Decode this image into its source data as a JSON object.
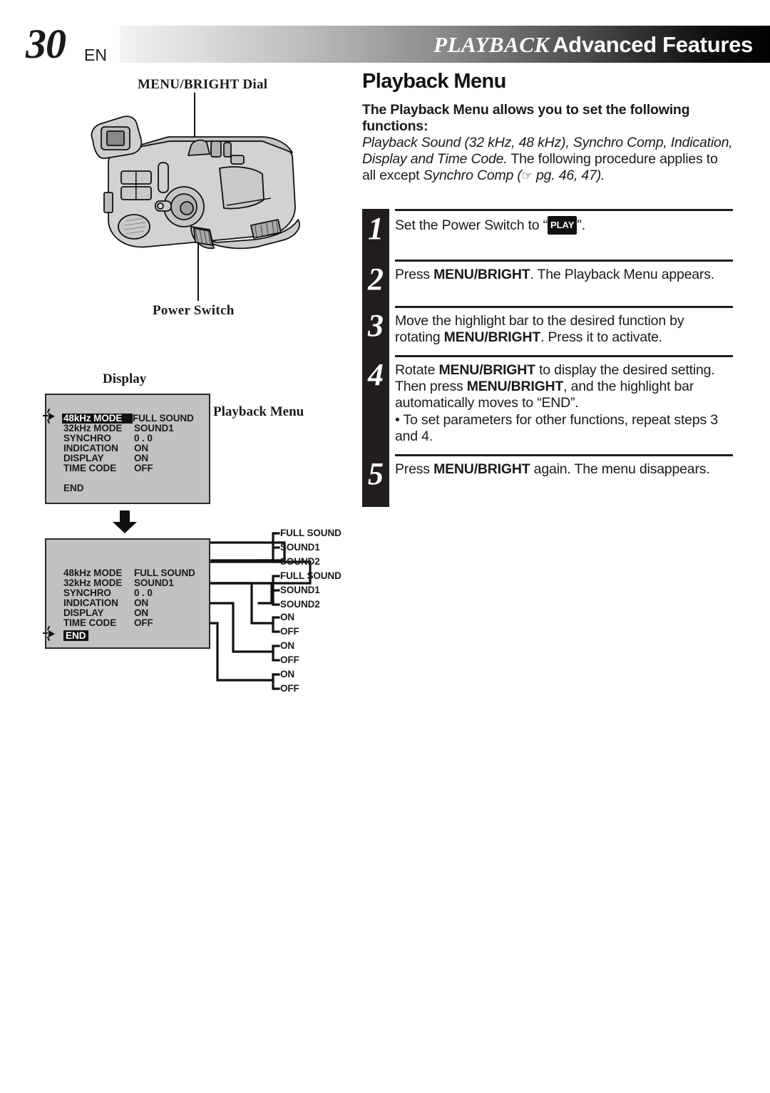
{
  "header": {
    "page_number": "30",
    "language": "EN",
    "title_italic": "PLAYBACK",
    "title_bold": "Advanced Features"
  },
  "illustration": {
    "label_dial": "MENU/BRIGHT Dial",
    "label_power": "Power Switch"
  },
  "screens": {
    "label_display": "Display",
    "label_playback_menu": "Playback Menu",
    "columns": [
      "function",
      "setting"
    ],
    "screen1": {
      "rows": [
        {
          "name": "48kHz  MODE",
          "value": "FULL SOUND",
          "highlighted": true
        },
        {
          "name": "32kHz  MODE",
          "value": "SOUND1",
          "highlighted": false
        },
        {
          "name": "SYNCHRO",
          "value": "0 . 0",
          "highlighted": false
        },
        {
          "name": "INDICATION",
          "value": "ON",
          "highlighted": false
        },
        {
          "name": "DISPLAY",
          "value": "ON",
          "highlighted": false
        },
        {
          "name": "TIME CODE",
          "value": "OFF",
          "highlighted": false
        }
      ],
      "end_label": "END",
      "end_highlighted": false
    },
    "screen2": {
      "rows": [
        {
          "name": "48kHz  MODE",
          "value": "FULL SOUND",
          "highlighted": false
        },
        {
          "name": "32kHz  MODE",
          "value": "SOUND1",
          "highlighted": false
        },
        {
          "name": "SYNCHRO",
          "value": "0 . 0",
          "highlighted": false
        },
        {
          "name": "INDICATION",
          "value": "ON",
          "highlighted": false
        },
        {
          "name": "DISPLAY",
          "value": "ON",
          "highlighted": false
        },
        {
          "name": "TIME CODE",
          "value": "OFF",
          "highlighted": false
        }
      ],
      "end_label": "END",
      "end_highlighted": true
    },
    "branches": [
      {
        "from": "48kHz  MODE",
        "options": [
          "FULL SOUND",
          "SOUND1",
          "SOUND2"
        ]
      },
      {
        "from": "32kHz  MODE",
        "options": [
          "FULL SOUND",
          "SOUND1",
          "SOUND2"
        ]
      },
      {
        "from": "INDICATION",
        "options": [
          "ON",
          "OFF"
        ]
      },
      {
        "from": "DISPLAY",
        "options": [
          "ON",
          "OFF"
        ]
      },
      {
        "from": "TIME CODE",
        "options": [
          "ON",
          "OFF"
        ]
      }
    ],
    "branch_options_flat": [
      "FULL SOUND",
      "SOUND1",
      "SOUND2",
      "FULL SOUND",
      "SOUND1",
      "SOUND2",
      "ON",
      "OFF",
      "ON",
      "OFF",
      "ON",
      "OFF"
    ]
  },
  "main": {
    "heading": "Playback Menu",
    "intro_bold": "The Playback Menu allows you to set the following functions:",
    "intro_italic_a": "Playback Sound (32 kHz, 48 kHz), Synchro Comp, Indication, Display and Time Code.",
    "intro_plain_b": " The following procedure applies to all except ",
    "intro_italic_c": "Synchro Comp",
    "intro_page_ref": " pg. 46, 47)."
  },
  "steps": [
    {
      "number": "1",
      "text_before": "Set the Power Switch to “",
      "badge": "PLAY",
      "text_after": "”."
    },
    {
      "number": "2",
      "text_before": "Press ",
      "bold": "MENU/BRIGHT",
      "text_after": ". The Playback Menu appears."
    },
    {
      "number": "3",
      "text_before": "Move the highlight bar to the desired function by rotating ",
      "bold": "MENU/BRIGHT",
      "text_after": ". Press it to activate."
    },
    {
      "number": "4",
      "line1_before": "Rotate ",
      "line1_bold": "MENU/BRIGHT",
      "line1_after": " to display the desired setting. Then press ",
      "line2_bold": "MENU/BRIGHT",
      "line2_after": ", and the highlight bar automatically moves to “END”.",
      "bullet": "• To set parameters for other functions, repeat steps 3 and 4."
    },
    {
      "number": "5",
      "text_before": "Press ",
      "bold": "MENU/BRIGHT",
      "text_after": " again. The menu disappears."
    }
  ],
  "colors": {
    "ink": "#1a1a1a",
    "bar": "#211d1d",
    "lcd_bg": "#c1c1c1",
    "highlight_bg": "#111111",
    "highlight_fg": "#ffffff"
  },
  "icons": {
    "pointing_hand": "☞",
    "down_arrow": "down-arrow-icon",
    "blink_marker": "blinking-cursor-icon"
  }
}
